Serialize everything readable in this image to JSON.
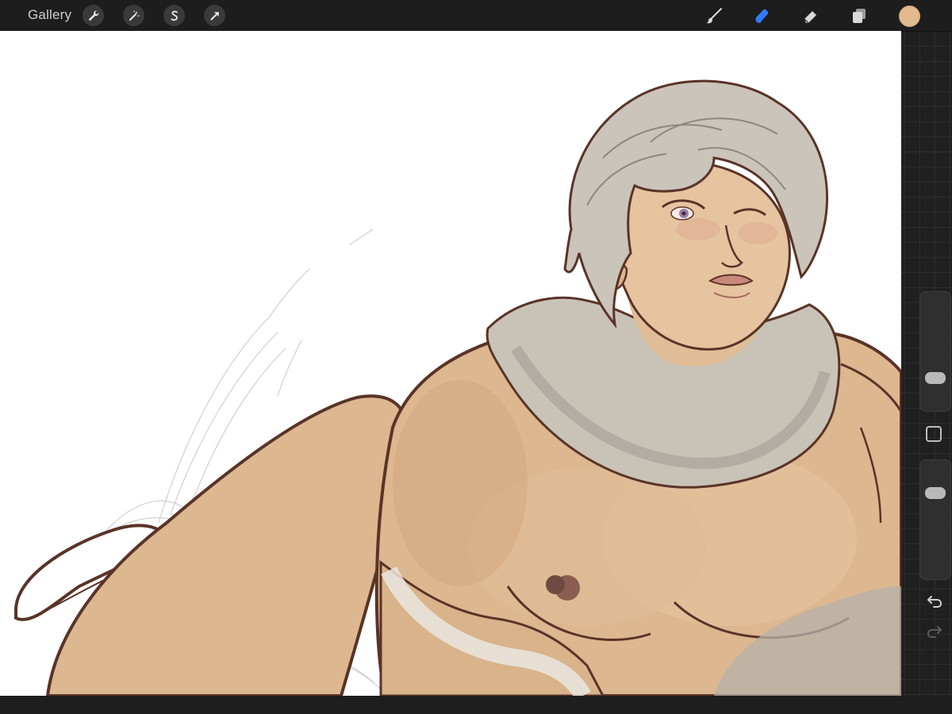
{
  "app": {
    "gallery_label": "Gallery"
  },
  "toolbar": {
    "left_icons": [
      "wrench-icon",
      "magic-wand-icon",
      "selection-icon",
      "transform-arrow-icon"
    ],
    "right_tools": [
      "brush-icon",
      "smudge-icon",
      "eraser-icon",
      "layers-icon"
    ],
    "active_tool": "smudge",
    "accent_color": "#2f7bff",
    "current_color": "#e3b98f"
  },
  "sidebar": {
    "brush_size_level": 0.78,
    "opacity_level": 0.22,
    "modify_button_icon": "square-icon",
    "undo_icon": "undo-arrow-icon",
    "redo_icon": "redo-arrow-icon"
  },
  "canvas": {
    "skin_color": "#dcb78f",
    "hair_color": "#c9c3b9",
    "scarf_color": "#c4beb2",
    "line_color": "#5a3328"
  }
}
